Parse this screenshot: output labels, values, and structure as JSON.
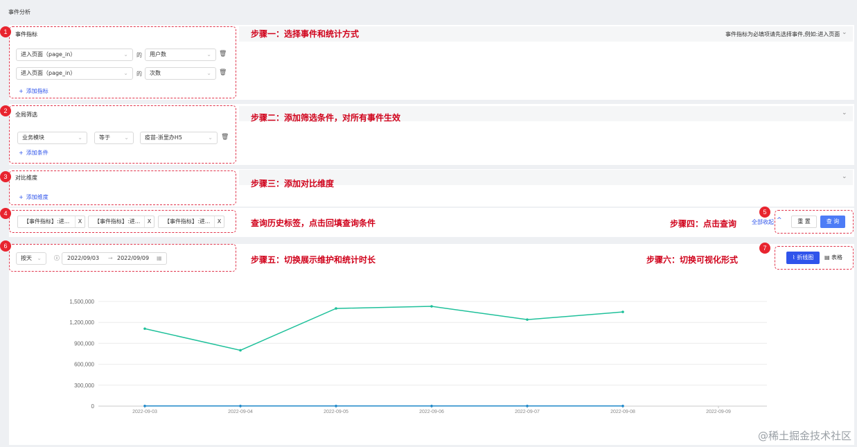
{
  "page": {
    "title": "事件分析"
  },
  "badges": [
    "1",
    "2",
    "3",
    "4",
    "5",
    "6",
    "7"
  ],
  "event_metrics": {
    "title": "事件指标",
    "hint": "事件指标为必填项请先选择事件,例如:进入页面",
    "rows": [
      {
        "event": "进入页面（page_in）",
        "connector": "的",
        "measure": "用户数"
      },
      {
        "event": "进入页面（page_in）",
        "connector": "的",
        "measure": "次数"
      }
    ],
    "add_label": "添加指标"
  },
  "global_filter": {
    "title": "全局筛选",
    "field": "业务模块",
    "operator": "等于",
    "value": "疫苗-浙里办H5",
    "add_label": "添加条件"
  },
  "compare_dimension": {
    "title": "对比维度",
    "add_label": "添加维度"
  },
  "history_tags": {
    "tags": [
      "【事件指标】:进...",
      "【事件指标】:进...",
      "【事件指标】:进..."
    ],
    "close_glyph": "X",
    "collapse_label": "全部收起",
    "reset_label": "重 置",
    "query_label": "查 询"
  },
  "time_controls": {
    "granularity": "按天",
    "start_date": "2022/09/03",
    "end_date": "2022/09/09",
    "line_chart_label": "折线图",
    "table_label": "表格"
  },
  "annotations": {
    "step1": "步骤一：选择事件和统计方式",
    "step2": "步骤二：添加筛选条件，对所有事件生效",
    "step3": "步骤三：添加对比维度",
    "history": "查询历史标签，点击回填查询条件",
    "step4": "步骤四：点击查询",
    "step5": "步骤五：切换展示维护和统计时长",
    "step6": "步骤六：切换可视化形式"
  },
  "colors": {
    "primary": "#4d7cf6",
    "annotation": "#d0021b",
    "badge": "#e8242f",
    "series_green": "#1ec09a",
    "series_blue": "#1e88c9"
  },
  "chart_data": {
    "type": "line",
    "categories": [
      "2022-09-03",
      "2022-09-04",
      "2022-09-05",
      "2022-09-06",
      "2022-09-07",
      "2022-09-08",
      "2022-09-09"
    ],
    "y_ticks": [
      "0",
      "300,000",
      "600,000",
      "900,000",
      "1,200,000",
      "1,500,000"
    ],
    "ylim": [
      0,
      1500000
    ],
    "series": [
      {
        "values": [
          1110000,
          800000,
          1400000,
          1430000,
          1240000,
          1350000,
          null
        ],
        "color": "#1ec09a"
      },
      {
        "values": [
          2000,
          2000,
          2000,
          2000,
          2000,
          2000,
          null
        ],
        "color": "#1e88c9"
      }
    ],
    "grid": true
  },
  "watermark": "@稀土掘金技术社区"
}
